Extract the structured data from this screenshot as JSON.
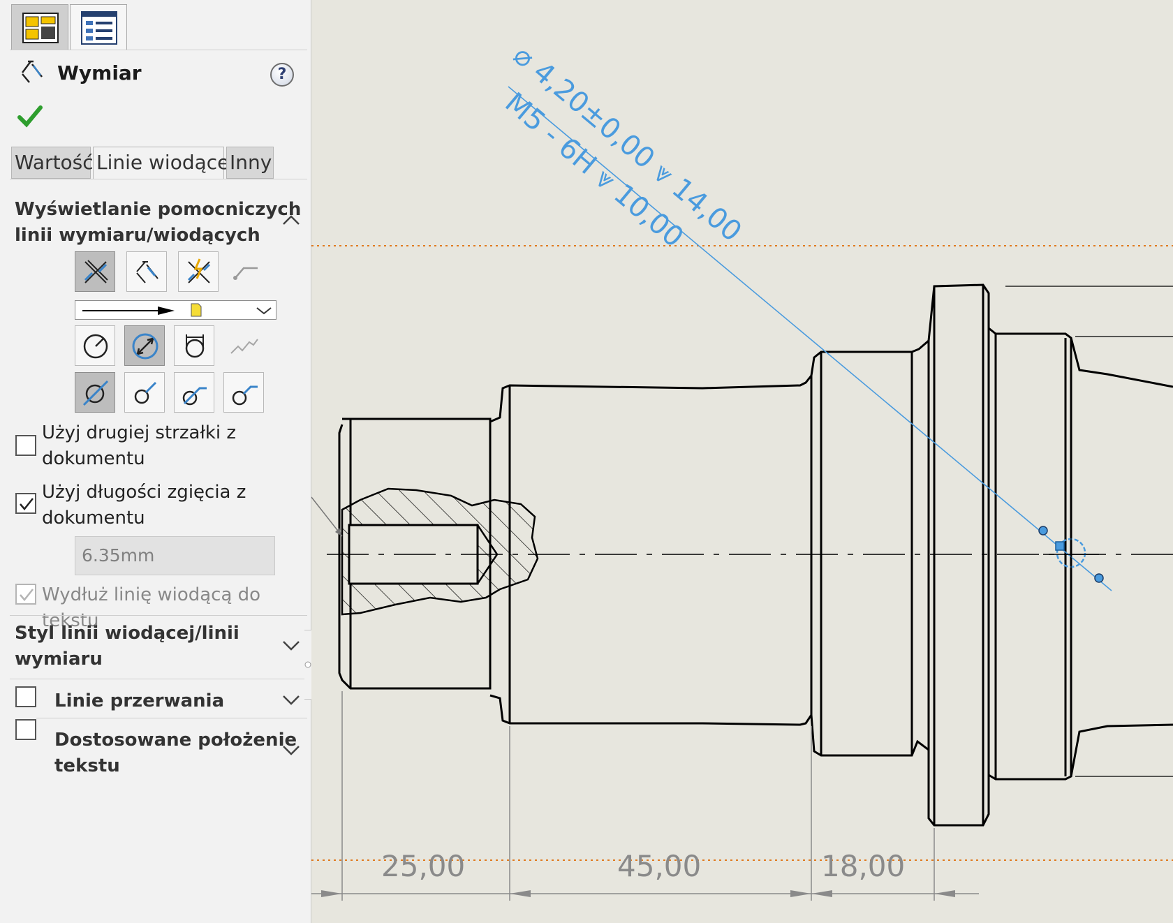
{
  "manager_tabs": [
    {
      "name": "property-manager-tab",
      "icon": "property-manager-icon",
      "selected": true
    },
    {
      "name": "feature-tree-tab",
      "icon": "feature-tree-icon",
      "selected": false
    }
  ],
  "header": {
    "title": "Wymiar",
    "icon": "dimension-icon",
    "help_label": "?"
  },
  "tabs": [
    {
      "label": "Wartość",
      "active": false
    },
    {
      "label": "Linie wiodące",
      "active": true
    },
    {
      "label": "Inny",
      "active": false
    }
  ],
  "sections": {
    "witness": {
      "title_line1": "Wyświetlanie pomocniczych",
      "title_line2": "linii wymiaru/wiodących",
      "expanded": true
    },
    "leader_style": {
      "title_line1": "Styl linii wiodącej/linii",
      "title_line2": "wymiaru",
      "expanded": false
    },
    "break_lines": {
      "title": "Linie przerwania",
      "checked": false,
      "expanded": false
    },
    "custom_text": {
      "title_line1": "Dostosowane położenie",
      "title_line2": "tekstu",
      "checked": false,
      "expanded": false
    }
  },
  "checkboxes": {
    "second_arrow": {
      "line1": "Użyj drugiej strzałki z",
      "line2": "dokumentu",
      "checked": false
    },
    "bent_length": {
      "line1": "Użyj długości zgięcia z",
      "line2": "dokumentu",
      "checked": true
    },
    "extend_leader": {
      "label": "Wydłuż linię wiodącą do tekstu",
      "checked": true,
      "disabled": true
    }
  },
  "bent_length_value": "6.35mm",
  "drawing": {
    "hole_callout_line1": "⌀ 4,20±0,00 ⩔ 14,00",
    "hole_callout_line2": "M5 - 6H ⩔ 10,00",
    "dimensions": [
      "25,00",
      "45,00",
      "18,00"
    ],
    "accent_color": "#4a9bde",
    "sketch_line_color": "#e07a1f"
  }
}
